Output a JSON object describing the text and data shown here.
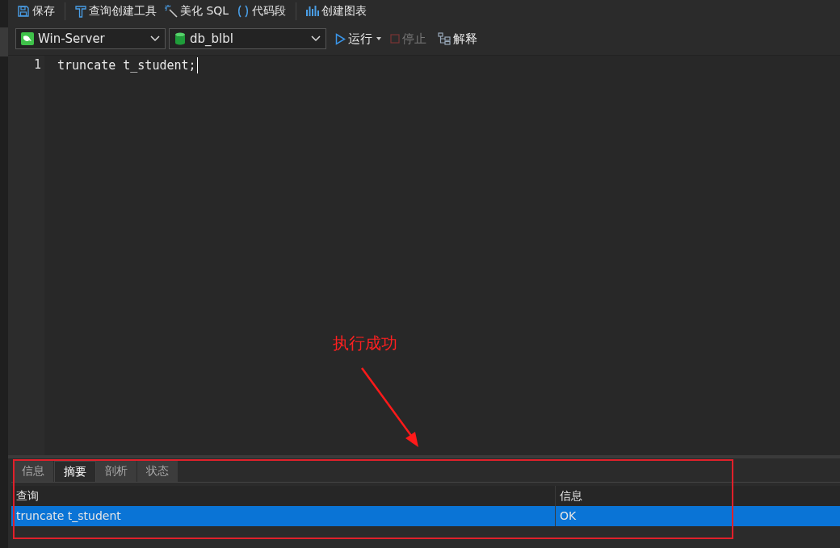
{
  "toolbar": [
    {
      "kind": "save",
      "label": "保存"
    },
    {
      "kind": "query-builder",
      "label": "查询创建工具"
    },
    {
      "kind": "beautify",
      "label": "美化 SQL"
    },
    {
      "kind": "snippet",
      "label": "代码段"
    },
    {
      "kind": "chart",
      "label": "创建图表"
    }
  ],
  "connection": {
    "value": "Win-Server"
  },
  "database": {
    "value": "db_blbl"
  },
  "actions": [
    {
      "kind": "run",
      "label": "运行",
      "disabled": false
    },
    {
      "kind": "stop",
      "label": "停止",
      "disabled": true
    },
    {
      "kind": "explain",
      "label": "解释",
      "disabled": false
    }
  ],
  "editor": {
    "lines": [
      {
        "number": "1",
        "code": "truncate t_student;"
      }
    ]
  },
  "result_tabs": [
    {
      "label": "信息",
      "selected": false
    },
    {
      "label": "摘要",
      "selected": true
    },
    {
      "label": "剖析",
      "selected": false
    },
    {
      "label": "状态",
      "selected": false
    }
  ],
  "result_table": {
    "columns": [
      "查询",
      "信息"
    ],
    "rows": [
      {
        "cells": [
          "truncate t_student",
          "OK"
        ],
        "selected": true
      }
    ]
  },
  "annotation": {
    "text": "执行成功"
  }
}
